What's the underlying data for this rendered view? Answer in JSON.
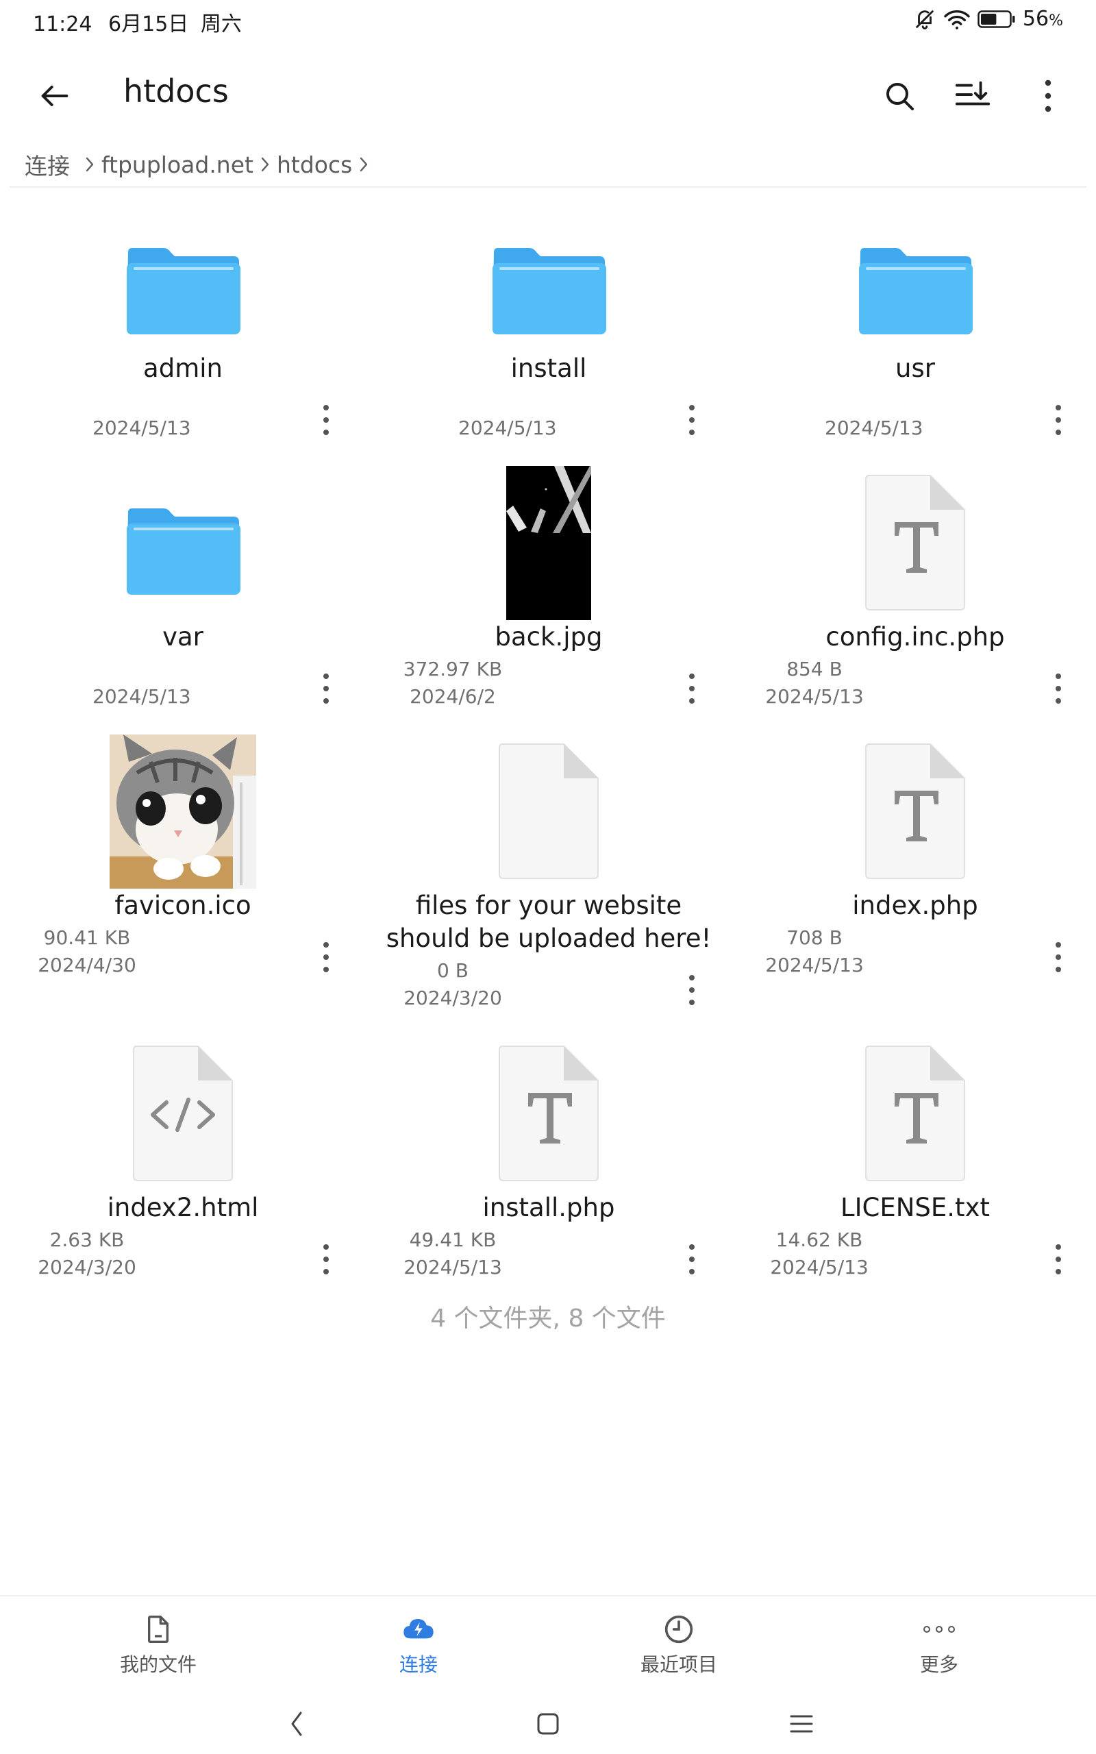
{
  "status_bar": {
    "time": "11:24",
    "date": "6月15日",
    "weekday": "周六",
    "battery_percent": "56",
    "battery_unit": "%",
    "battery_level": 0.56
  },
  "app_bar": {
    "title": "htdocs"
  },
  "breadcrumb": {
    "items": [
      "连接",
      "ftpupload.net",
      "htdocs"
    ]
  },
  "files": [
    {
      "name": "admin",
      "size": "",
      "date": "2024/5/13",
      "kind": "folder"
    },
    {
      "name": "install",
      "size": "",
      "date": "2024/5/13",
      "kind": "folder"
    },
    {
      "name": "usr",
      "size": "",
      "date": "2024/5/13",
      "kind": "folder"
    },
    {
      "name": "var",
      "size": "",
      "date": "2024/5/13",
      "kind": "folder"
    },
    {
      "name": "back.jpg",
      "size": "372.97 KB",
      "date": "2024/6/2",
      "kind": "image-dark"
    },
    {
      "name": "config.inc.php",
      "size": "854 B",
      "date": "2024/5/13",
      "kind": "text"
    },
    {
      "name": "favicon.ico",
      "size": "90.41 KB",
      "date": "2024/4/30",
      "kind": "image-cat"
    },
    {
      "name": "files for your website should be uploaded here!",
      "size": "0 B",
      "date": "2024/3/20",
      "kind": "blank"
    },
    {
      "name": "index.php",
      "size": "708 B",
      "date": "2024/5/13",
      "kind": "text"
    },
    {
      "name": "index2.html",
      "size": "2.63 KB",
      "date": "2024/3/20",
      "kind": "code"
    },
    {
      "name": "install.php",
      "size": "49.41 KB",
      "date": "2024/5/13",
      "kind": "text"
    },
    {
      "name": "LICENSE.txt",
      "size": "14.62 KB",
      "date": "2024/5/13",
      "kind": "text"
    }
  ],
  "summary": "4 个文件夹, 8 个文件",
  "bottom_nav": {
    "items": [
      "我的文件",
      "连接",
      "最近项目",
      "更多"
    ],
    "active": "连接"
  },
  "colors": {
    "accent": "#2f7de1",
    "folder": "#52bdf7"
  }
}
